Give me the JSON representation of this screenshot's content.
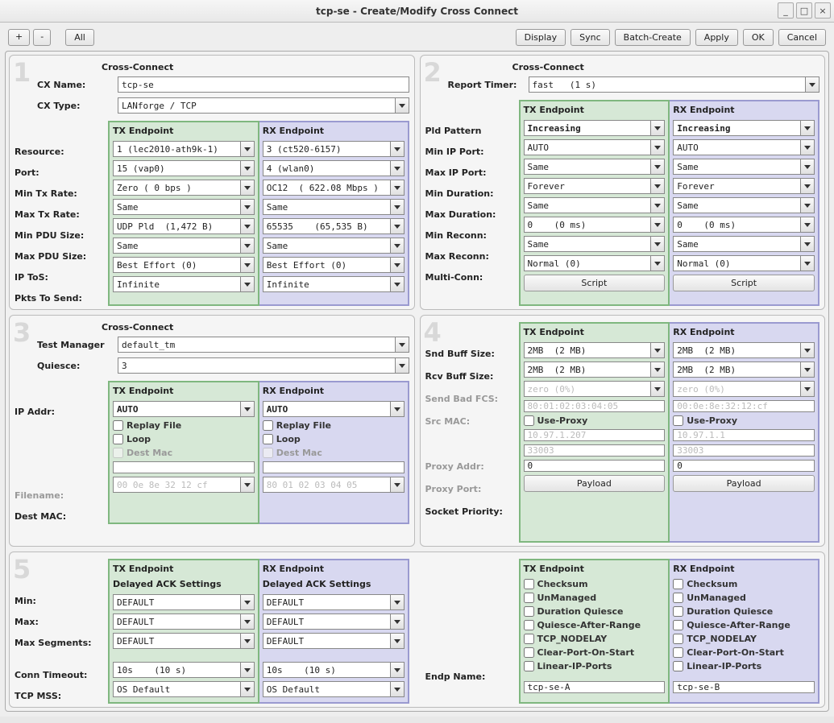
{
  "window": {
    "title": "tcp-se - Create/Modify Cross Connect"
  },
  "toolbar": {
    "plus": "+",
    "minus": "-",
    "all": "All",
    "display": "Display",
    "sync": "Sync",
    "batch": "Batch-Create",
    "apply": "Apply",
    "ok": "OK",
    "cancel": "Cancel"
  },
  "p1": {
    "heading": "Cross-Connect",
    "cx_name_lbl": "CX Name:",
    "cx_name": "tcp-se",
    "cx_type_lbl": "CX Type:",
    "cx_type": "LANforge / TCP",
    "tx_hdr": "TX Endpoint",
    "rx_hdr": "RX Endpoint",
    "resource_lbl": "Resource:",
    "tx_resource": "1 (lec2010-ath9k-1)",
    "rx_resource": "3 (ct520-6157)",
    "port_lbl": "Port:",
    "tx_port": "15 (vap0)",
    "rx_port": "4 (wlan0)",
    "min_tx_lbl": "Min Tx Rate:",
    "tx_min": "Zero ( 0 bps )",
    "rx_min": "OC12  ( 622.08 Mbps )",
    "max_tx_lbl": "Max Tx Rate:",
    "tx_max": "Same",
    "rx_max": "Same",
    "min_pdu_lbl": "Min PDU Size:",
    "tx_min_pdu": "UDP Pld  (1,472 B)",
    "rx_min_pdu": "65535    (65,535 B)",
    "max_pdu_lbl": "Max PDU Size:",
    "tx_max_pdu": "Same",
    "rx_max_pdu": "Same",
    "tos_lbl": "IP ToS:",
    "tx_tos": "Best Effort (0)",
    "rx_tos": "Best Effort (0)",
    "pkts_lbl": "Pkts To Send:",
    "tx_pkts": "Infinite",
    "rx_pkts": "Infinite"
  },
  "p2": {
    "heading": "Cross-Connect",
    "timer_lbl": "Report Timer:",
    "timer": "fast   (1 s)",
    "tx_hdr": "TX Endpoint",
    "rx_hdr": "RX Endpoint",
    "pld_lbl": "Pld Pattern",
    "tx_pld": "Increasing",
    "rx_pld": "Increasing",
    "minip_lbl": "Min IP Port:",
    "tx_minip": "AUTO",
    "rx_minip": "AUTO",
    "maxip_lbl": "Max IP Port:",
    "tx_maxip": "Same",
    "rx_maxip": "Same",
    "mindur_lbl": "Min Duration:",
    "tx_mindur": "Forever",
    "rx_mindur": "Forever",
    "maxdur_lbl": "Max Duration:",
    "tx_maxdur": "Same",
    "rx_maxdur": "Same",
    "minrec_lbl": "Min Reconn:",
    "tx_minrec": "0    (0 ms)",
    "rx_minrec": "0    (0 ms)",
    "maxrec_lbl": "Max Reconn:",
    "tx_maxrec": "Same",
    "rx_maxrec": "Same",
    "multi_lbl": "Multi-Conn:",
    "tx_multi": "Normal (0)",
    "rx_multi": "Normal (0)",
    "script": "Script"
  },
  "p3": {
    "heading": "Cross-Connect",
    "tm_lbl": "Test Manager",
    "tm": "default_tm",
    "q_lbl": "Quiesce:",
    "q": "3",
    "tx_hdr": "TX Endpoint",
    "rx_hdr": "RX Endpoint",
    "ip_lbl": "IP Addr:",
    "tx_ip": "AUTO",
    "rx_ip": "AUTO",
    "replay": "Replay File",
    "loop": "Loop",
    "destmac": "Dest Mac",
    "fn_lbl": "Filename:",
    "dm_lbl": "Dest MAC:",
    "tx_dm": "00 0e 8e 32 12 cf",
    "rx_dm": "80 01 02 03 04 05"
  },
  "p4": {
    "tx_hdr": "TX Endpoint",
    "rx_hdr": "RX Endpoint",
    "snd_lbl": "Snd Buff Size:",
    "tx_snd": "2MB  (2 MB)",
    "rx_snd": "2MB  (2 MB)",
    "rcv_lbl": "Rcv Buff Size:",
    "tx_rcv": "2MB  (2 MB)",
    "rx_rcv": "2MB  (2 MB)",
    "fcs_lbl": "Send Bad FCS:",
    "tx_fcs": "zero (0%)",
    "rx_fcs": "zero (0%)",
    "src_lbl": "Src MAC:",
    "tx_src": "80:01:02:03:04:05",
    "rx_src": "00:0e:8e:32:12:cf",
    "proxy": "Use-Proxy",
    "paddr_lbl": "Proxy Addr:",
    "tx_paddr": "10.97.1.207",
    "rx_paddr": "10.97.1.1",
    "pport_lbl": "Proxy Port:",
    "tx_pport": "33003",
    "rx_pport": "33003",
    "sprio_lbl": "Socket Priority:",
    "tx_sprio": "0",
    "rx_sprio": "0",
    "payload": "Payload"
  },
  "p5": {
    "tx_hdr": "TX Endpoint",
    "rx_hdr": "RX Endpoint",
    "sub": "Delayed ACK Settings",
    "min_lbl": "Min:",
    "tx_min": "DEFAULT",
    "rx_min": "DEFAULT",
    "max_lbl": "Max:",
    "tx_max": "DEFAULT",
    "rx_max": "DEFAULT",
    "seg_lbl": "Max Segments:",
    "tx_seg": "DEFAULT",
    "rx_seg": "DEFAULT",
    "ct_lbl": "Conn Timeout:",
    "tx_ct": "10s    (10 s)",
    "rx_ct": "10s    (10 s)",
    "mss_lbl": "TCP MSS:",
    "tx_mss": "OS Default",
    "rx_mss": "OS Default",
    "chk_checksum": "Checksum",
    "chk_unmanaged": "UnManaged",
    "chk_dq": "Duration Quiesce",
    "chk_qar": "Quiesce-After-Range",
    "chk_nodelay": "TCP_NODELAY",
    "chk_clear": "Clear-Port-On-Start",
    "chk_linear": "Linear-IP-Ports",
    "endp_lbl": "Endp Name:",
    "endp_a": "tcp-se-A",
    "endp_b": "tcp-se-B"
  }
}
